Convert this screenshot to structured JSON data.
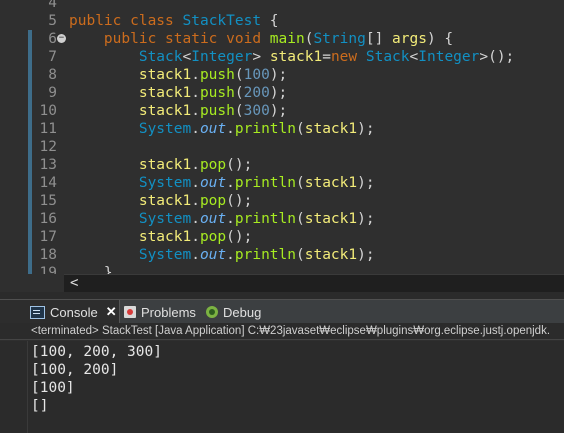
{
  "editor": {
    "lines": [
      {
        "num": "4",
        "tokens": []
      },
      {
        "num": "5",
        "tokens": [
          {
            "c": "kw",
            "t": "public class "
          },
          {
            "c": "ty",
            "t": "StackTest"
          },
          {
            "c": "sc",
            "t": " {"
          }
        ]
      },
      {
        "num": "6",
        "fold": "−",
        "tokens": [
          {
            "c": "kw",
            "t": "    public static void "
          },
          {
            "c": "fn",
            "t": "main"
          },
          {
            "c": "sc",
            "t": "("
          },
          {
            "c": "ty",
            "t": "String"
          },
          {
            "c": "sc",
            "t": "[] "
          },
          {
            "c": "var",
            "t": "args"
          },
          {
            "c": "sc",
            "t": ") {"
          }
        ]
      },
      {
        "num": "7",
        "tokens": [
          {
            "c": "ty",
            "t": "        Stack"
          },
          {
            "c": "sc",
            "t": "<"
          },
          {
            "c": "ty",
            "t": "Integer"
          },
          {
            "c": "sc",
            "t": "> "
          },
          {
            "c": "var",
            "t": "stack1"
          },
          {
            "c": "sc",
            "t": "="
          },
          {
            "c": "kw",
            "t": "new "
          },
          {
            "c": "ty",
            "t": "Stack"
          },
          {
            "c": "sc",
            "t": "<"
          },
          {
            "c": "ty",
            "t": "Integer"
          },
          {
            "c": "sc",
            "t": ">();"
          }
        ]
      },
      {
        "num": "8",
        "tokens": [
          {
            "c": "var",
            "t": "        stack1"
          },
          {
            "c": "sc",
            "t": "."
          },
          {
            "c": "fn",
            "t": "push"
          },
          {
            "c": "sc",
            "t": "("
          },
          {
            "c": "nm",
            "t": "100"
          },
          {
            "c": "sc",
            "t": ");"
          }
        ]
      },
      {
        "num": "9",
        "tokens": [
          {
            "c": "var",
            "t": "        stack1"
          },
          {
            "c": "sc",
            "t": "."
          },
          {
            "c": "fn",
            "t": "push"
          },
          {
            "c": "sc",
            "t": "("
          },
          {
            "c": "nm",
            "t": "200"
          },
          {
            "c": "sc",
            "t": ");"
          }
        ]
      },
      {
        "num": "10",
        "tokens": [
          {
            "c": "var",
            "t": "        stack1"
          },
          {
            "c": "sc",
            "t": "."
          },
          {
            "c": "fn",
            "t": "push"
          },
          {
            "c": "sc",
            "t": "("
          },
          {
            "c": "nm",
            "t": "300"
          },
          {
            "c": "sc",
            "t": ");"
          }
        ]
      },
      {
        "num": "11",
        "tokens": [
          {
            "c": "ty",
            "t": "        System"
          },
          {
            "c": "sc",
            "t": "."
          },
          {
            "c": "it",
            "t": "out"
          },
          {
            "c": "sc",
            "t": "."
          },
          {
            "c": "fn",
            "t": "println"
          },
          {
            "c": "sc",
            "t": "("
          },
          {
            "c": "var",
            "t": "stack1"
          },
          {
            "c": "sc",
            "t": ");"
          }
        ]
      },
      {
        "num": "12",
        "tokens": []
      },
      {
        "num": "13",
        "tokens": [
          {
            "c": "var",
            "t": "        stack1"
          },
          {
            "c": "sc",
            "t": "."
          },
          {
            "c": "fn",
            "t": "pop"
          },
          {
            "c": "sc",
            "t": "();"
          }
        ]
      },
      {
        "num": "14",
        "tokens": [
          {
            "c": "ty",
            "t": "        System"
          },
          {
            "c": "sc",
            "t": "."
          },
          {
            "c": "it",
            "t": "out"
          },
          {
            "c": "sc",
            "t": "."
          },
          {
            "c": "fn",
            "t": "println"
          },
          {
            "c": "sc",
            "t": "("
          },
          {
            "c": "var",
            "t": "stack1"
          },
          {
            "c": "sc",
            "t": ");"
          }
        ]
      },
      {
        "num": "15",
        "tokens": [
          {
            "c": "var",
            "t": "        stack1"
          },
          {
            "c": "sc",
            "t": "."
          },
          {
            "c": "fn",
            "t": "pop"
          },
          {
            "c": "sc",
            "t": "();"
          }
        ]
      },
      {
        "num": "16",
        "tokens": [
          {
            "c": "ty",
            "t": "        System"
          },
          {
            "c": "sc",
            "t": "."
          },
          {
            "c": "it",
            "t": "out"
          },
          {
            "c": "sc",
            "t": "."
          },
          {
            "c": "fn",
            "t": "println"
          },
          {
            "c": "sc",
            "t": "("
          },
          {
            "c": "var",
            "t": "stack1"
          },
          {
            "c": "sc",
            "t": ");"
          }
        ]
      },
      {
        "num": "17",
        "tokens": [
          {
            "c": "var",
            "t": "        stack1"
          },
          {
            "c": "sc",
            "t": "."
          },
          {
            "c": "fn",
            "t": "pop"
          },
          {
            "c": "sc",
            "t": "();"
          }
        ]
      },
      {
        "num": "18",
        "tokens": [
          {
            "c": "ty",
            "t": "        System"
          },
          {
            "c": "sc",
            "t": "."
          },
          {
            "c": "it",
            "t": "out"
          },
          {
            "c": "sc",
            "t": "."
          },
          {
            "c": "fn",
            "t": "println"
          },
          {
            "c": "sc",
            "t": "("
          },
          {
            "c": "var",
            "t": "stack1"
          },
          {
            "c": "sc",
            "t": ");"
          }
        ]
      },
      {
        "num": "19",
        "tokens": [
          {
            "c": "sc",
            "t": "    }"
          }
        ]
      }
    ]
  },
  "scrollbar": {
    "left_arrow": "<"
  },
  "panel": {
    "tabs": [
      {
        "label": "Console",
        "icon": "console-icon",
        "close": "✕"
      },
      {
        "label": "Problems",
        "icon": "problems-icon"
      },
      {
        "label": "Debug",
        "icon": "debug-icon"
      }
    ],
    "status": "<terminated> StackTest [Java Application] C:₩23javaset₩eclipse₩plugins₩org.eclipse.justj.openjdk.",
    "output": [
      "[100, 200, 300]",
      "[100, 200]",
      "[100]",
      "[]"
    ]
  }
}
